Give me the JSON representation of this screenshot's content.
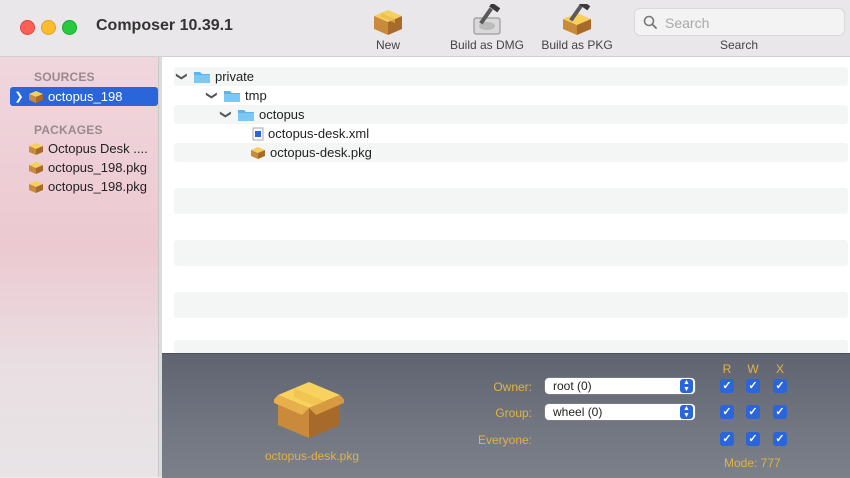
{
  "app": {
    "title": "Composer 10.39.1"
  },
  "toolbar": {
    "new_label": "New",
    "build_dmg_label": "Build as DMG",
    "build_pkg_label": "Build as PKG",
    "search_placeholder": "Search",
    "search_label": "Search"
  },
  "sidebar": {
    "sources_header": "SOURCES",
    "sources": [
      {
        "label": "octopus_198",
        "selected": true
      }
    ],
    "packages_header": "PACKAGES",
    "packages": [
      {
        "label": "Octopus Desk ...."
      },
      {
        "label": "octopus_198.pkg"
      },
      {
        "label": "octopus_198.pkg"
      }
    ]
  },
  "tree": {
    "items": [
      {
        "label": "private",
        "type": "folder",
        "expanded": true
      },
      {
        "label": "tmp",
        "type": "folder",
        "expanded": true
      },
      {
        "label": "octopus",
        "type": "folder",
        "expanded": true
      },
      {
        "label": "octopus-desk.xml",
        "type": "xml"
      },
      {
        "label": "octopus-desk.pkg",
        "type": "package"
      }
    ]
  },
  "info": {
    "file_name": "octopus-desk.pkg",
    "owner_label": "Owner:",
    "owner_value": "root (0)",
    "group_label": "Group:",
    "group_value": "wheel (0)",
    "everyone_label": "Everyone:",
    "col_r": "R",
    "col_w": "W",
    "col_x": "X",
    "mode": "Mode: 777",
    "checkmark": "✓"
  },
  "colors": {
    "accent": "#2a66d9",
    "label_gold": "#e4b340"
  }
}
